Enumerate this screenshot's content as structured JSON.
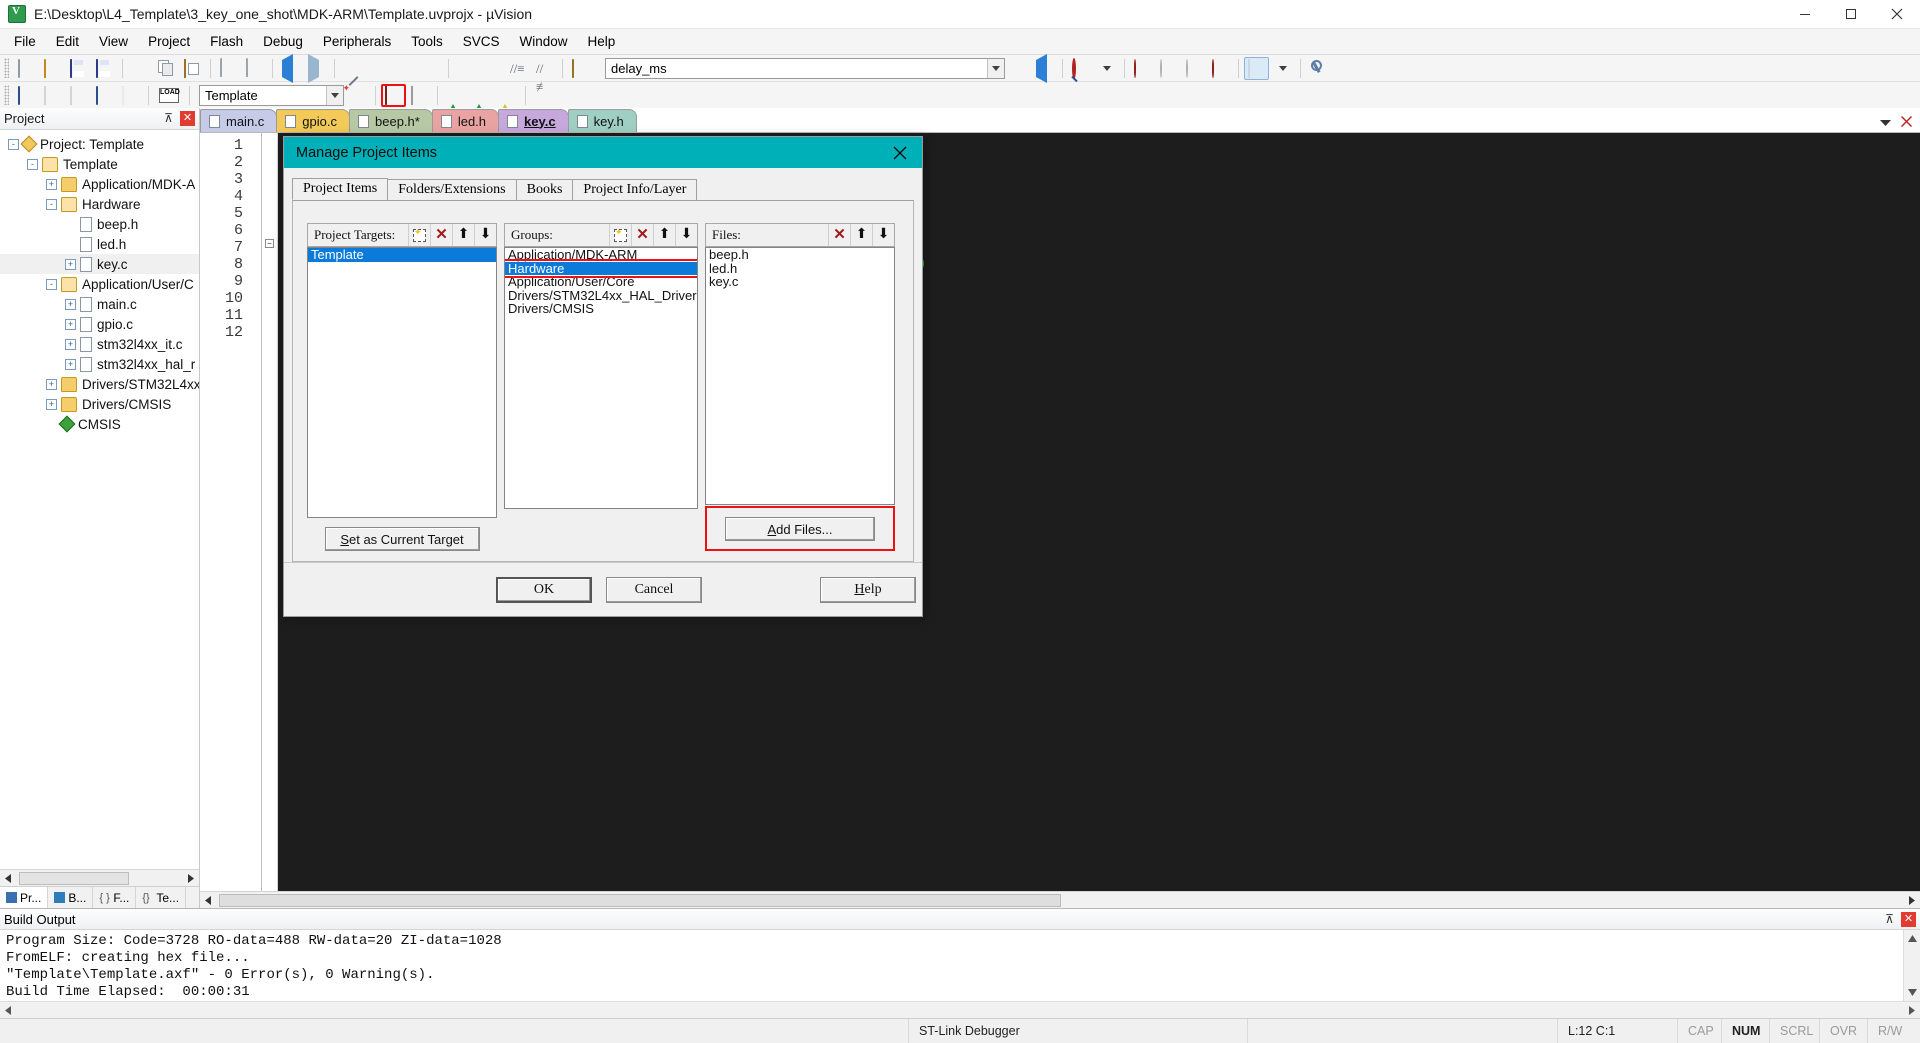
{
  "window": {
    "title": "E:\\Desktop\\L4_Template\\3_key_one_shot\\MDK-ARM\\Template.uvprojx - µVision",
    "app_icon": "uvision-icon",
    "minimize": "minimize-button",
    "maximize": "maximize-button",
    "close": "close-button"
  },
  "menubar": {
    "items": [
      "File",
      "Edit",
      "View",
      "Project",
      "Flash",
      "Debug",
      "Peripherals",
      "Tools",
      "SVCS",
      "Window",
      "Help"
    ]
  },
  "toolbar1": {
    "icons": [
      "new-file-icon",
      "open-file-icon",
      "save-icon",
      "save-all-icon",
      "cut-icon",
      "copy-icon",
      "paste-icon",
      "undo-icon",
      "redo-icon",
      "navigate-back-icon",
      "navigate-forward-icon",
      "bookmark-toggle-icon",
      "bookmark-prev-icon",
      "bookmark-next-icon",
      "bookmark-clear-icon",
      "indent-icon",
      "outdent-icon",
      "comment-icon",
      "uncomment-icon",
      "open-workspace-icon"
    ],
    "function_box_value": "delay_ms",
    "function_box_placeholder": "delay_ms",
    "right_icons": [
      "combo-dropdown-icon",
      "configure-icon",
      "download-icon",
      "find-icon",
      "find-dropdown-icon",
      "insert-breakpoint-icon",
      "kill-breakpoints-icon",
      "disable-breakpoint-icon",
      "enable-breakpoints-icon",
      "window-layout-icon",
      "layout-dropdown-icon",
      "configure-tools-icon"
    ]
  },
  "toolbar2": {
    "icons": [
      "translate-icon",
      "build-icon",
      "rebuild-icon",
      "batch-build-icon",
      "stop-build-icon",
      "load-icon"
    ],
    "target_value": "Template",
    "target_dropdown": "target-dropdown-icon",
    "right_icons": [
      "target-options-icon",
      "manage-run-time-env-icon",
      "manage-project-items-icon",
      "multi-project-icon",
      "books-icon",
      "functions-icon",
      "templates-icon"
    ]
  },
  "project_panel": {
    "title": "Project",
    "pin_icon": "pin-icon",
    "close_icon": "close-icon",
    "tree": [
      {
        "label": "Project: Template",
        "indent": 0,
        "expander": "-",
        "icon": "project-icon"
      },
      {
        "label": "Template",
        "indent": 1,
        "expander": "-",
        "icon": "target-folder-icon"
      },
      {
        "label": "Application/MDK-A",
        "indent": 2,
        "expander": "+",
        "icon": "folder-icon"
      },
      {
        "label": "Hardware",
        "indent": 2,
        "expander": "-",
        "icon": "folder-open-icon"
      },
      {
        "label": "beep.h",
        "indent": 3,
        "expander": "",
        "icon": "file-icon"
      },
      {
        "label": "led.h",
        "indent": 3,
        "expander": "",
        "icon": "file-icon"
      },
      {
        "label": "key.c",
        "indent": 3,
        "expander": "+",
        "icon": "file-icon",
        "selected": true
      },
      {
        "label": "Application/User/C",
        "indent": 2,
        "expander": "-",
        "icon": "folder-open-icon"
      },
      {
        "label": "main.c",
        "indent": 3,
        "expander": "+",
        "icon": "file-icon"
      },
      {
        "label": "gpio.c",
        "indent": 3,
        "expander": "+",
        "icon": "file-icon"
      },
      {
        "label": "stm32l4xx_it.c",
        "indent": 3,
        "expander": "+",
        "icon": "file-icon"
      },
      {
        "label": "stm32l4xx_hal_r",
        "indent": 3,
        "expander": "+",
        "icon": "file-icon"
      },
      {
        "label": "Drivers/STM32L4xx_",
        "indent": 2,
        "expander": "+",
        "icon": "folder-icon"
      },
      {
        "label": "Drivers/CMSIS",
        "indent": 2,
        "expander": "+",
        "icon": "folder-icon"
      },
      {
        "label": "CMSIS",
        "indent": 2,
        "expander": "",
        "icon": "cmsis-icon"
      }
    ],
    "bottom_tabs": [
      {
        "label": "Pr...",
        "icon": "project-tab-icon",
        "active": true
      },
      {
        "label": "B...",
        "icon": "books-tab-icon",
        "active": false
      },
      {
        "label": "F...",
        "icon": "functions-tab-icon",
        "active": false
      },
      {
        "label": "Te...",
        "icon": "templates-tab-icon",
        "active": false
      }
    ]
  },
  "editor": {
    "tabs": [
      {
        "label": "main.c",
        "color": "#c6cbe8",
        "active": false
      },
      {
        "label": "gpio.c",
        "color": "#f3ca57",
        "active": false
      },
      {
        "label": "beep.h*",
        "color": "#b6c9a4",
        "active": false
      },
      {
        "label": "led.h",
        "color": "#eaa3a3",
        "active": false
      },
      {
        "label": "key.c",
        "color": "#c7a8dd",
        "active": true
      },
      {
        "label": "key.h",
        "color": "#9fcfc2",
        "active": false
      }
    ],
    "line_numbers": [
      "1",
      "2",
      "3",
      "4",
      "5",
      "6",
      "7",
      "8",
      "9",
      "10",
      "11",
      "12"
    ],
    "code_snippet": ")",
    "collapse_icon": "fold-collapse-icon"
  },
  "dialog": {
    "title": "Manage Project Items",
    "close_icon": "close-icon",
    "tabs": [
      {
        "label": "Project Items",
        "active": true
      },
      {
        "label": "Folders/Extensions",
        "active": false
      },
      {
        "label": "Books",
        "active": false
      },
      {
        "label": "Project Info/Layer",
        "active": false
      }
    ],
    "targets": {
      "label": "Project Targets:",
      "toolbar_icons": [
        "new-item-icon",
        "delete-item-icon",
        "move-up-icon",
        "move-down-icon"
      ],
      "items": [
        {
          "label": "Template",
          "selected": true
        }
      ],
      "button": "Set as Current Target",
      "button_accesskey": "S"
    },
    "groups": {
      "label": "Groups:",
      "toolbar_icons": [
        "new-item-icon",
        "delete-item-icon",
        "move-up-icon",
        "move-down-icon"
      ],
      "items": [
        {
          "label": "Application/MDK-ARM",
          "selected": false
        },
        {
          "label": "Hardware",
          "selected": true,
          "highlighted": true
        },
        {
          "label": "Application/User/Core",
          "selected": false
        },
        {
          "label": "Drivers/STM32L4xx_HAL_Driver",
          "selected": false
        },
        {
          "label": "Drivers/CMSIS",
          "selected": false
        }
      ]
    },
    "files": {
      "label": "Files:",
      "toolbar_icons": [
        "delete-item-icon",
        "move-up-icon",
        "move-down-icon"
      ],
      "items": [
        {
          "label": "beep.h",
          "selected": false
        },
        {
          "label": "led.h",
          "selected": false
        },
        {
          "label": "key.c",
          "selected": false
        }
      ],
      "button": "Add Files...",
      "button_accesskey": "A",
      "button_highlighted": true
    },
    "footer": {
      "ok": "OK",
      "cancel": "Cancel",
      "help": "Help"
    }
  },
  "build_output": {
    "title": "Build Output",
    "pin_icon": "pin-icon",
    "close_icon": "close-icon",
    "lines": [
      "Program Size: Code=3728 RO-data=488 RW-data=20 ZI-data=1028",
      "FromELF: creating hex file...",
      "\"Template\\Template.axf\" - 0 Error(s), 0 Warning(s).",
      "Build Time Elapsed:  00:00:31"
    ]
  },
  "statusbar": {
    "debugger": "ST-Link Debugger",
    "position": "L:12 C:1",
    "indicators": [
      "CAP",
      "NUM",
      "SCRL",
      "OVR",
      "R/W"
    ],
    "active_indicator": "NUM"
  },
  "colors": {
    "dialog_titlebar": "#00b0b9",
    "selection_blue": "#0b7ad8",
    "highlight_red": "#ee1111",
    "editor_background": "#1d1d1d"
  }
}
